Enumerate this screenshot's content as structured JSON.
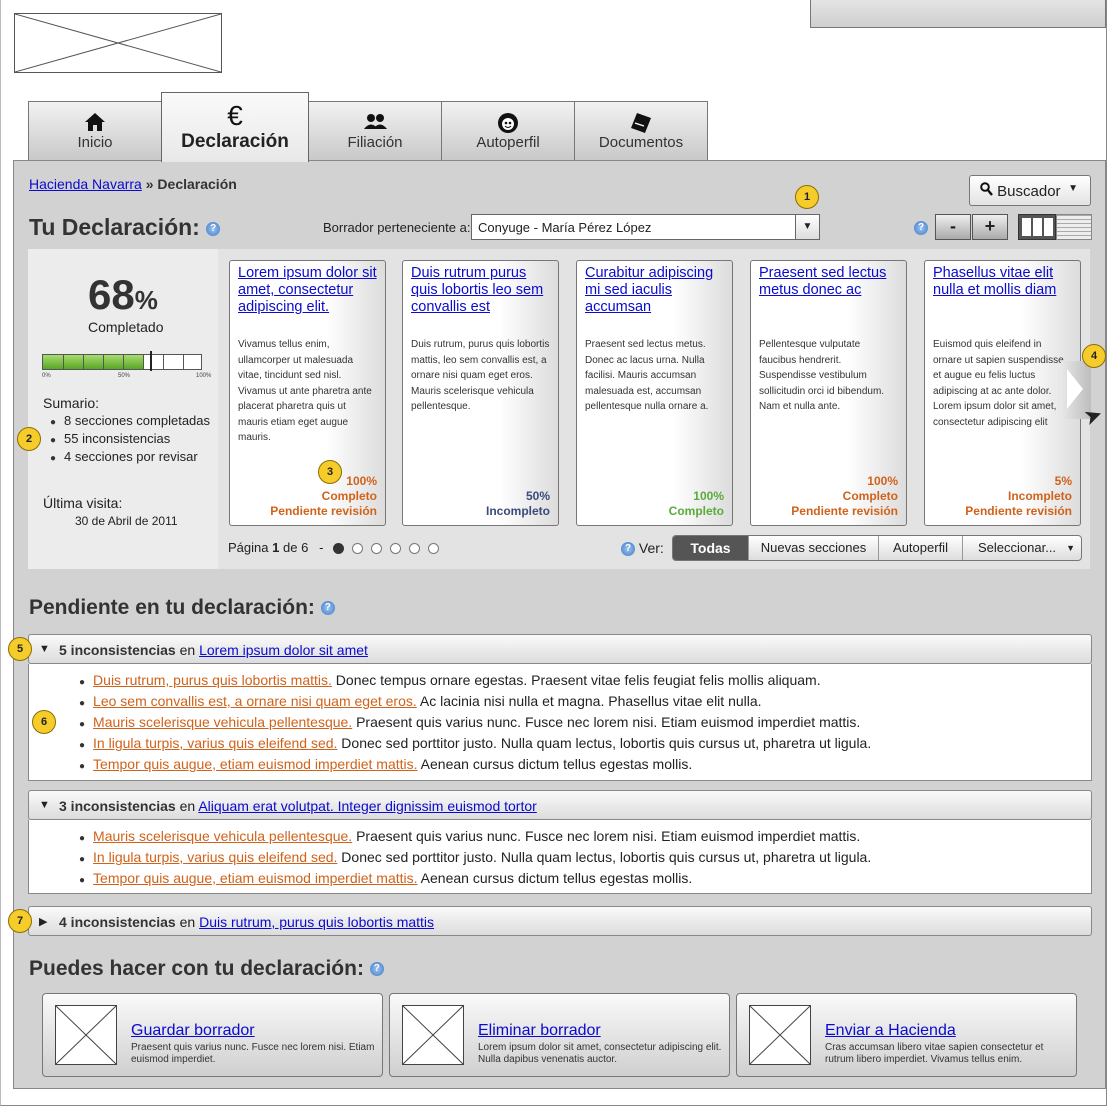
{
  "tabs": [
    {
      "label": "Inicio",
      "icon": "home-icon"
    },
    {
      "label": "Declaración",
      "icon": "euro-icon"
    },
    {
      "label": "Filiación",
      "icon": "people-icon"
    },
    {
      "label": "Autoperfil",
      "icon": "face-icon"
    },
    {
      "label": "Documentos",
      "icon": "document-icon"
    }
  ],
  "breadcrumb": {
    "link": "Hacienda Navarra",
    "separator": "»",
    "current": "Declaración"
  },
  "search": {
    "label": "Buscador"
  },
  "declaration": {
    "title": "Tu Declaración:",
    "owner_label": "Borrador perteneciente a:",
    "owner_value": "Conyuge - María Pérez López"
  },
  "zoom": {
    "minus": "-",
    "plus": "+"
  },
  "summary": {
    "percent": "68",
    "percent_sign": "%",
    "completed_label": "Completado",
    "progress": 0.68,
    "scale": [
      "0%",
      "50%",
      "100%"
    ],
    "title": "Sumario:",
    "items": [
      "8 secciones completadas",
      "55 inconsistencias",
      "4 secciones por revisar"
    ],
    "last_visit_label": "Última visita:",
    "last_visit_date": "30 de Abril de 2011"
  },
  "cards": [
    {
      "title": "Lorem ipsum dolor sit amet, consectetur adipiscing elit.",
      "body": "Vivamus tellus enim, ullamcorper ut malesuada vitae, tincidunt sed nisl. Vivamus ut ante pharetra ante placerat pharetra quis ut mauris etiam eget augue mauris.",
      "percent": "100%",
      "status": "Completo",
      "review": "Pendiente revisión",
      "color": "#d0621a"
    },
    {
      "title": "Duis rutrum purus quis lobortis leo sem convallis est",
      "body": "Duis rutrum, purus quis lobortis mattis, leo sem convallis est, a ornare nisi quam eget eros. Mauris scelerisque vehicula pellentesque.",
      "percent": "50%",
      "status": "Incompleto",
      "review": "",
      "color": "#3a4a7a"
    },
    {
      "title": "Curabitur adipiscing mi sed iaculis accumsan",
      "body": "Praesent sed lectus metus. Donec ac lacus urna. Nulla facilisi. Mauris accumsan malesuada est, accumsan pellentesque nulla ornare a.",
      "percent": "100%",
      "status": "Completo",
      "review": "",
      "color": "#5aab3b"
    },
    {
      "title": "Praesent sed lectus metus donec ac",
      "body": "Pellentesque vulputate faucibus hendrerit. Suspendisse vestibulum sollicitudin orci id bibendum. Nam et nulla ante.",
      "percent": "100%",
      "status": "Completo",
      "review": "Pendiente revisión",
      "color": "#d0621a"
    },
    {
      "title": "Phasellus vitae elit nulla et mollis diam",
      "body": "Euismod quis eleifend in ornare ut sapien suspendisse et augue eu felis luctus adipiscing at ac ante dolor. Lorem ipsum dolor sit amet, consectetur adipiscing elit",
      "percent": "5%",
      "status": "Incompleto",
      "review": "Pendiente revisión",
      "color": "#d0621a"
    }
  ],
  "pager": {
    "text_prefix": "Página",
    "current": "1",
    "text_mid": "de",
    "total": "6",
    "dash": "-"
  },
  "filter": {
    "label": "Ver:",
    "options": [
      "Todas",
      "Nuevas secciones",
      "Autoperfil",
      "Seleccionar..."
    ],
    "selected": "Todas"
  },
  "pending": {
    "title": "Pendiente en tu declaración:",
    "groups": [
      {
        "count": "5 inconsistencias",
        "conj": "en",
        "section": "Lorem ipsum dolor sit amet",
        "expanded": true,
        "items": [
          {
            "link": "Duis rutrum, purus quis lobortis mattis.",
            "text": "Donec tempus ornare egestas. Praesent vitae felis feugiat felis mollis aliquam."
          },
          {
            "link": "Leo sem convallis est, a ornare nisi quam eget eros.",
            "text": "Ac lacinia nisi nulla et magna. Phasellus vitae elit nulla."
          },
          {
            "link": "Mauris scelerisque vehicula pellentesque.",
            "text": "Praesent quis varius nunc. Fusce nec lorem nisi. Etiam euismod imperdiet mattis."
          },
          {
            "link": "In ligula turpis, varius quis eleifend sed.",
            "text": "Donec sed porttitor justo. Nulla quam lectus, lobortis quis cursus ut, pharetra ut ligula."
          },
          {
            "link": "Tempor quis augue, etiam euismod imperdiet mattis.",
            "text": "Aenean cursus dictum tellus egestas mollis."
          }
        ]
      },
      {
        "count": "3 inconsistencias",
        "conj": "en",
        "section": "Aliquam erat volutpat. Integer dignissim euismod tortor",
        "expanded": true,
        "items": [
          {
            "link": "Mauris scelerisque vehicula pellentesque.",
            "text": "Praesent quis varius nunc. Fusce nec lorem nisi. Etiam euismod imperdiet mattis."
          },
          {
            "link": "In ligula turpis, varius quis eleifend sed.",
            "text": "Donec sed porttitor justo. Nulla quam lectus, lobortis quis cursus ut, pharetra ut ligula."
          },
          {
            "link": "Tempor quis augue, etiam euismod imperdiet mattis.",
            "text": "Aenean cursus dictum tellus egestas mollis."
          }
        ]
      },
      {
        "count": "4 inconsistencias",
        "conj": "en",
        "section": "Duis rutrum, purus quis lobortis mattis",
        "expanded": false,
        "items": []
      }
    ]
  },
  "actions": {
    "title": "Puedes hacer con tu declaración:",
    "items": [
      {
        "title": "Guardar borrador",
        "desc": "Praesent quis varius nunc. Fusce nec lorem nisi. Etiam euismod imperdiet."
      },
      {
        "title": "Eliminar borrador",
        "desc": "Lorem ipsum dolor sit amet, consectetur adipiscing elit. Nulla dapibus venenatis auctor."
      },
      {
        "title": "Enviar a Hacienda",
        "desc": "Cras accumsan libero vitae sapien consectetur et rutrum libero imperdiet. Vivamus tellus enim."
      }
    ]
  },
  "annotations": [
    "1",
    "2",
    "3",
    "4",
    "5",
    "6",
    "7"
  ],
  "colors": {
    "accent_orange": "#d0621a",
    "link_blue": "#0a0ad0",
    "badge_yellow": "#f6cc2b",
    "progress_green": "#59a524"
  }
}
